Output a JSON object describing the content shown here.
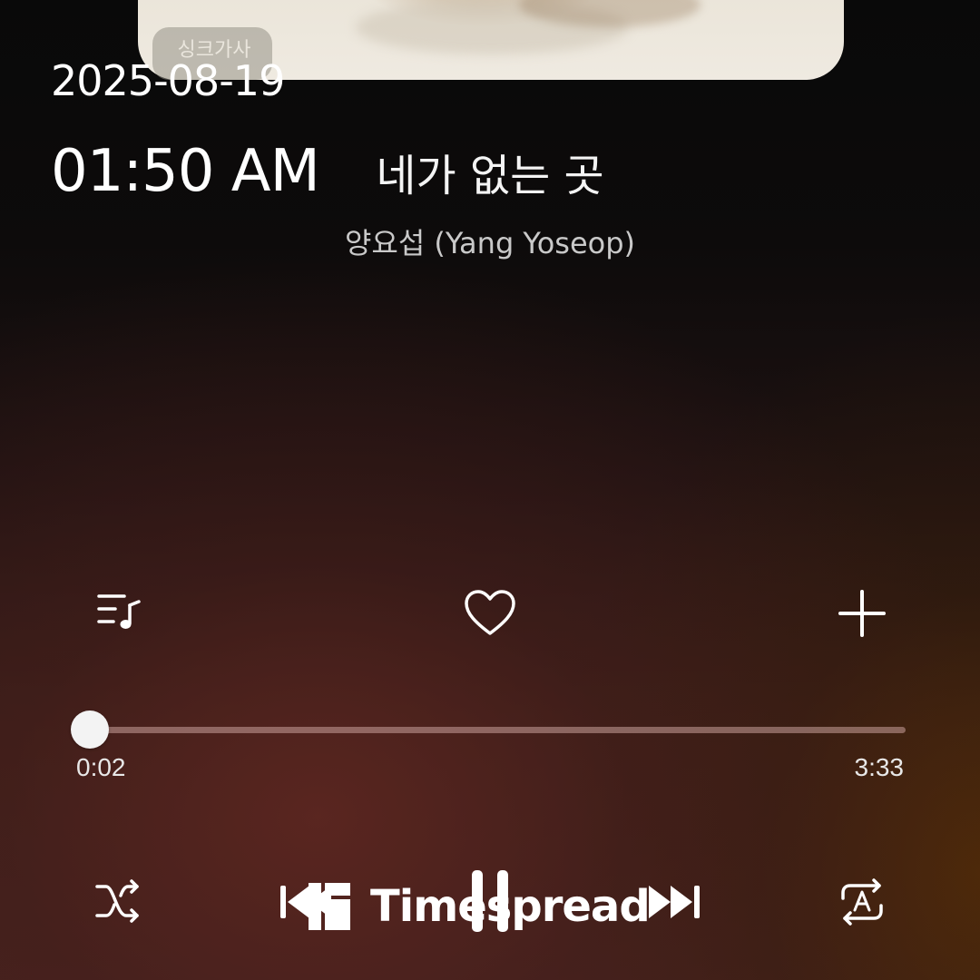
{
  "status": {
    "date": "2025-08-19",
    "time": "01:50 AM"
  },
  "album": {
    "sync_lyrics_label": "싱크가사"
  },
  "track": {
    "title": "네가 없는 곳",
    "artist": "양요섭 (Yang Yoseop)"
  },
  "actions": {
    "playlist_icon": "playlist-music-icon",
    "like_icon": "heart-outline-icon",
    "add_icon": "plus-icon"
  },
  "progress": {
    "elapsed": "0:02",
    "duration": "3:33",
    "fraction": 0.0094
  },
  "controls": {
    "shuffle_icon": "shuffle-icon",
    "prev_icon": "skip-previous-icon",
    "pause_icon": "pause-icon",
    "next_icon": "skip-next-icon",
    "repeat_icon": "repeat-a-icon"
  },
  "watermark": {
    "text": "Timespread"
  },
  "colors": {
    "icon": "#ffffff",
    "track_bg": "#c8a09b"
  }
}
